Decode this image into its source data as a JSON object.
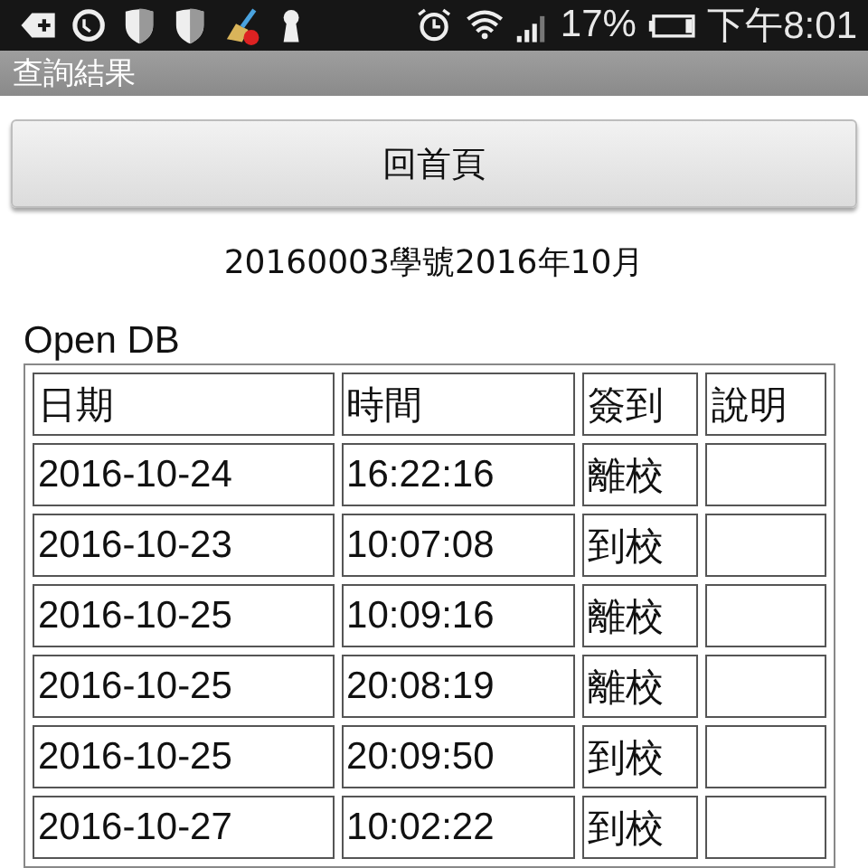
{
  "status_bar": {
    "battery_percent": "17%",
    "time": "下午8:01"
  },
  "title_bar": {
    "title": "查詢結果"
  },
  "home_button": {
    "label": "回首頁"
  },
  "subtitle": "20160003學號2016年10月",
  "db_label": "Open DB",
  "table": {
    "columns": [
      "日期",
      "時間",
      "簽到",
      "說明"
    ],
    "rows": [
      [
        "2016-10-24",
        "16:22:16",
        "離校",
        ""
      ],
      [
        "2016-10-23",
        "10:07:08",
        "到校",
        ""
      ],
      [
        "2016-10-25",
        "10:09:16",
        "離校",
        ""
      ],
      [
        "2016-10-25",
        "20:08:19",
        "離校",
        ""
      ],
      [
        "2016-10-25",
        "20:09:50",
        "到校",
        ""
      ],
      [
        "2016-10-27",
        "10:02:22",
        "到校",
        ""
      ]
    ]
  }
}
